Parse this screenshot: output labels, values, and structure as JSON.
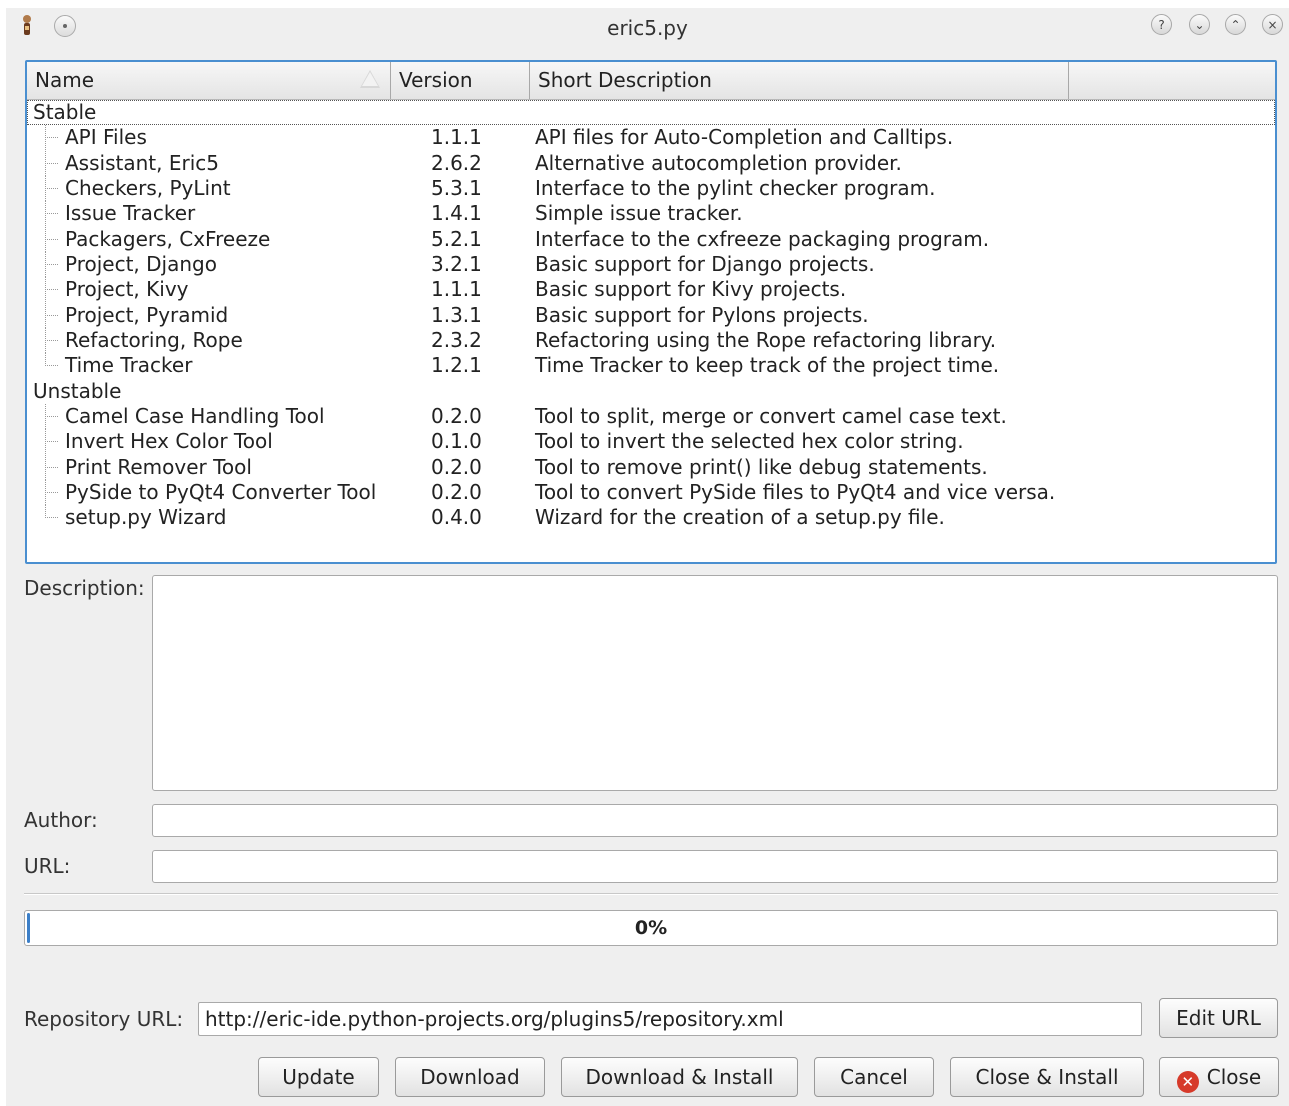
{
  "window": {
    "title": "eric5.py"
  },
  "tree": {
    "columns": [
      "Name",
      "Version",
      "Short Description",
      ""
    ],
    "groups": [
      {
        "label": "Stable",
        "items": [
          {
            "name": "API Files",
            "version": "1.1.1",
            "description": "API files for Auto-Completion and Calltips."
          },
          {
            "name": "Assistant, Eric5",
            "version": "2.6.2",
            "description": "Alternative autocompletion provider."
          },
          {
            "name": "Checkers, PyLint",
            "version": "5.3.1",
            "description": "Interface to the pylint checker program."
          },
          {
            "name": "Issue Tracker",
            "version": "1.4.1",
            "description": "Simple issue tracker."
          },
          {
            "name": "Packagers, CxFreeze",
            "version": "5.2.1",
            "description": "Interface to the cxfreeze packaging program."
          },
          {
            "name": "Project, Django",
            "version": "3.2.1",
            "description": "Basic support for Django projects."
          },
          {
            "name": "Project, Kivy",
            "version": "1.1.1",
            "description": "Basic support for Kivy projects."
          },
          {
            "name": "Project, Pyramid",
            "version": "1.3.1",
            "description": "Basic support for Pylons projects."
          },
          {
            "name": "Refactoring, Rope",
            "version": "2.3.2",
            "description": "Refactoring using the Rope refactoring library."
          },
          {
            "name": "Time Tracker",
            "version": "1.2.1",
            "description": "Time Tracker to keep track of the project time."
          }
        ]
      },
      {
        "label": "Unstable",
        "items": [
          {
            "name": "Camel Case Handling Tool",
            "version": "0.2.0",
            "description": "Tool to split, merge or convert camel case text."
          },
          {
            "name": "Invert Hex Color Tool",
            "version": "0.1.0",
            "description": "Tool to invert the selected hex color string."
          },
          {
            "name": "Print Remover Tool",
            "version": "0.2.0",
            "description": "Tool to remove print() like debug statements."
          },
          {
            "name": "PySide to PyQt4 Converter Tool",
            "version": "0.2.0",
            "description": "Tool to convert PySide files to PyQt4 and vice versa."
          },
          {
            "name": "setup.py Wizard",
            "version": "0.4.0",
            "description": "Wizard for the creation of a setup.py file."
          }
        ]
      }
    ]
  },
  "form": {
    "description_label": "Description:",
    "author_label": "Author:",
    "url_label": "URL:",
    "progress": {
      "value": 0,
      "text": "0%"
    },
    "repository_url_label": "Repository URL:",
    "repository_url": "http://eric-ide.python-projects.org/plugins5/repository.xml",
    "edit_url_label": "Edit URL"
  },
  "buttons": {
    "update": "Update",
    "download": "Download",
    "download_install": "Download & Install",
    "cancel": "Cancel",
    "close_install": "Close & Install",
    "close": "Close"
  },
  "colors": {
    "accent": "#4a8fd0",
    "progress": "#3c7fc8",
    "close_icon": "#d63a2a"
  },
  "icons": {
    "title_help": "?",
    "title_minimize": "⌄",
    "title_maximize": "⌃",
    "title_close": "×",
    "close_button": "✕"
  }
}
